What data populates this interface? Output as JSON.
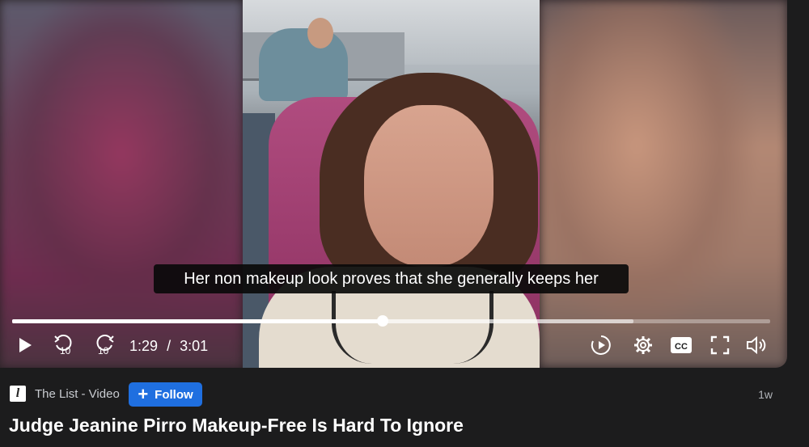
{
  "video": {
    "caption": "Her non makeup look proves that she generally keeps her",
    "current_time": "1:29",
    "separator": "/",
    "duration": "3:01",
    "played_fraction": 0.489,
    "buffered_fraction": 0.82,
    "rewind_label": "10",
    "forward_label": "10",
    "cc_label": "CC"
  },
  "post": {
    "logo_letter": "l",
    "channel": "The List - Video",
    "follow_label": "Follow",
    "age": "1w",
    "title": "Judge Jeanine Pirro Makeup-Free Is Hard To Ignore"
  },
  "colors": {
    "background": "#1c1c1d",
    "follow_button": "#1f6fe0",
    "caption_bg": "#0a0a0a"
  }
}
